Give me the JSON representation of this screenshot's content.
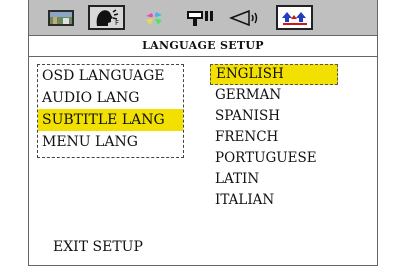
{
  "header": {
    "title": "LANGUAGE SETUP"
  },
  "tabs": [
    {
      "icon": "tv-picture-icon",
      "active": false
    },
    {
      "icon": "speaking-head-icon",
      "active": true
    },
    {
      "icon": "disc-icon",
      "active": false
    },
    {
      "icon": "speaker-icon",
      "active": false
    },
    {
      "icon": "volume-icon",
      "active": false
    },
    {
      "icon": "setup-arrows-icon",
      "active": false
    }
  ],
  "menu": {
    "items": [
      "OSD LANGUAGE",
      "AUDIO LANG",
      "SUBTITLE LANG",
      "MENU LANG"
    ],
    "selected": "SUBTITLE LANG"
  },
  "options": {
    "items": [
      "ENGLISH",
      "GERMAN",
      "SPANISH",
      "FRENCH",
      "PORTUGUESE",
      "LATIN",
      "ITALIAN"
    ],
    "selected": "ENGLISH"
  },
  "footer": {
    "exit_label": "EXIT SETUP"
  },
  "colors": {
    "highlight": "#f2e000",
    "tabbar": "#bfbfbf"
  }
}
